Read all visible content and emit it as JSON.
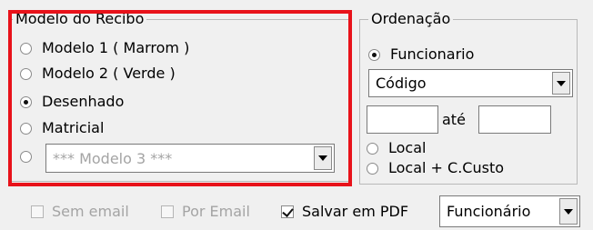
{
  "modelo_group": {
    "legend": "Modelo do Recibo",
    "options": [
      {
        "label": "Modelo 1 ( Marrom )",
        "checked": false
      },
      {
        "label": "Modelo 2 ( Verde )",
        "checked": false
      },
      {
        "label": "Desenhado",
        "checked": true
      },
      {
        "label": "Matricial",
        "checked": false
      }
    ],
    "combo_option_checked": false,
    "combo_value": "*** Modelo 3 ***",
    "highlight_color": "#e8121a"
  },
  "ordenacao_group": {
    "legend": "Ordenação",
    "funcionario_label": "Funcionario",
    "funcionario_checked": true,
    "order_combo_value": "Código",
    "range_from_value": "",
    "range_separator": "até",
    "range_to_value": "",
    "local_label": "Local",
    "local_checked": false,
    "local_custo_label": "Local + C.Custo",
    "local_custo_checked": false
  },
  "bottom": {
    "sem_email_label": "Sem email",
    "sem_email_checked": false,
    "sem_email_enabled": false,
    "por_email_label": "Por Email",
    "por_email_checked": false,
    "por_email_enabled": false,
    "salvar_pdf_label": "Salvar em PDF",
    "salvar_pdf_checked": true,
    "pdf_combo_value": "Funcionário"
  }
}
